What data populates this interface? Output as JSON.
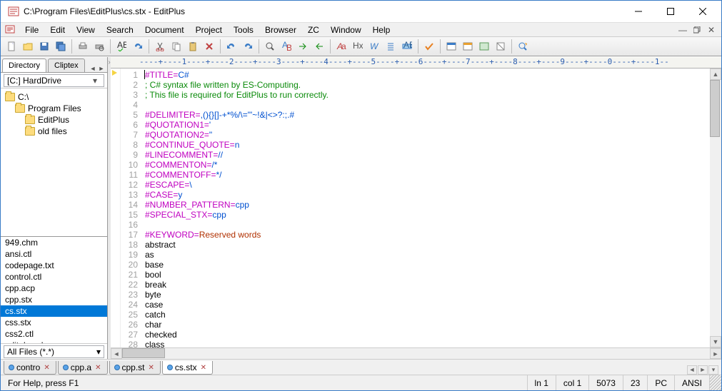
{
  "titlebar": {
    "title": "C:\\Program Files\\EditPlus\\cs.stx - EditPlus"
  },
  "menu": {
    "items": [
      "File",
      "Edit",
      "View",
      "Search",
      "Document",
      "Project",
      "Tools",
      "Browser",
      "ZC",
      "Window",
      "Help"
    ]
  },
  "sidebar": {
    "tabs": [
      "Directory",
      "Cliptex"
    ],
    "drive": "[C:] HardDrive",
    "tree": [
      {
        "indent": 0,
        "label": "C:\\"
      },
      {
        "indent": 1,
        "label": "Program Files"
      },
      {
        "indent": 2,
        "label": "EditPlus"
      },
      {
        "indent": 2,
        "label": "old files"
      }
    ],
    "files": [
      "949.chm",
      "ansi.ctl",
      "codepage.txt",
      "control.ctl",
      "cpp.acp",
      "cpp.stx",
      "cs.stx",
      "css.stx",
      "css2.ctl",
      "editplus.chm"
    ],
    "selected_file": "cs.stx",
    "filter": "All Files (*.*)"
  },
  "ruler": "----+----1----+----2----+----3----+----4----+----5----+----6----+----7----+----8----+----9----+----0----+----1--",
  "code": {
    "lines": [
      {
        "n": 1,
        "t": "kv",
        "key": "#TITLE",
        "val": "C#"
      },
      {
        "n": 2,
        "t": "cm",
        "text": "; C# syntax file written by ES-Computing."
      },
      {
        "n": 3,
        "t": "cm",
        "text": "; This file is required for EditPlus to run correctly."
      },
      {
        "n": 4,
        "t": "blank"
      },
      {
        "n": 5,
        "t": "kv",
        "key": "#DELIMITER",
        "val": ",(){}[]-+*%/\\=\"'~!&|<>?:;.#"
      },
      {
        "n": 6,
        "t": "kv",
        "key": "#QUOTATION1",
        "val": "'"
      },
      {
        "n": 7,
        "t": "kv",
        "key": "#QUOTATION2",
        "val": "\""
      },
      {
        "n": 8,
        "t": "kv",
        "key": "#CONTINUE_QUOTE",
        "val": "n"
      },
      {
        "n": 9,
        "t": "kv",
        "key": "#LINECOMMENT",
        "val": "//"
      },
      {
        "n": 10,
        "t": "kv",
        "key": "#COMMENTON",
        "val": "/*"
      },
      {
        "n": 11,
        "t": "kv",
        "key": "#COMMENTOFF",
        "val": "*/"
      },
      {
        "n": 12,
        "t": "kv",
        "key": "#ESCAPE",
        "val": "\\"
      },
      {
        "n": 13,
        "t": "kv",
        "key": "#CASE",
        "val": "y"
      },
      {
        "n": 14,
        "t": "kv",
        "key": "#NUMBER_PATTERN",
        "val": "cpp"
      },
      {
        "n": 15,
        "t": "kv",
        "key": "#SPECIAL_STX",
        "val": "cpp"
      },
      {
        "n": 16,
        "t": "blank"
      },
      {
        "n": 17,
        "t": "kvr",
        "key": "#KEYWORD",
        "val": "Reserved words"
      },
      {
        "n": 18,
        "t": "plain",
        "text": "abstract"
      },
      {
        "n": 19,
        "t": "plain",
        "text": "as"
      },
      {
        "n": 20,
        "t": "plain",
        "text": "base"
      },
      {
        "n": 21,
        "t": "plain",
        "text": "bool"
      },
      {
        "n": 22,
        "t": "plain",
        "text": "break"
      },
      {
        "n": 23,
        "t": "plain",
        "text": "byte"
      },
      {
        "n": 24,
        "t": "plain",
        "text": "case"
      },
      {
        "n": 25,
        "t": "plain",
        "text": "catch"
      },
      {
        "n": 26,
        "t": "plain",
        "text": "char"
      },
      {
        "n": 27,
        "t": "plain",
        "text": "checked"
      },
      {
        "n": 28,
        "t": "plain",
        "text": "class"
      }
    ]
  },
  "doctabs": [
    {
      "label": "contro",
      "active": false
    },
    {
      "label": "cpp.a",
      "active": false
    },
    {
      "label": "cpp.st",
      "active": false
    },
    {
      "label": "cs.stx",
      "active": true
    }
  ],
  "status": {
    "help": "For Help, press F1",
    "line": "ln 1",
    "col": "col 1",
    "count": "5073",
    "sel": "23",
    "enc": "PC",
    "cp": "ANSI"
  }
}
